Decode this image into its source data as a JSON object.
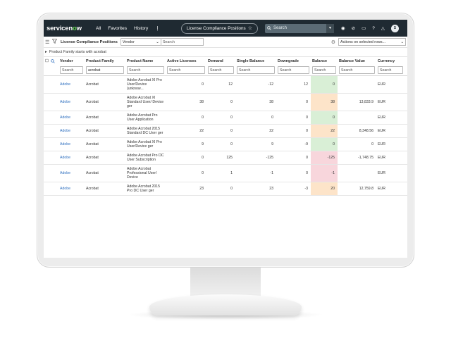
{
  "app": {
    "logo_text_a": "servicen",
    "logo_text_o": "o",
    "logo_text_b": "w",
    "nav": [
      "All",
      "Favorites",
      "History"
    ],
    "nav_more": "⋮",
    "page_title": "License Compliance Positions",
    "search_placeholder": "Search",
    "avatar_initial": "S"
  },
  "listbar": {
    "title": "License Compliance Positions",
    "field_select": "Vendor",
    "search_placeholder": "Search",
    "actions_label": "Actions on selected rows..."
  },
  "breadcrumb": "Product Family starts with acrobat",
  "columns": [
    "Vendor",
    "Product Family",
    "Product Name",
    "Active Licenses",
    "Demand",
    "Single Balance",
    "Downgrade",
    "Balance",
    "Balance Value",
    "Currency"
  ],
  "filters": {
    "vendor": "Search",
    "family": "acrobat",
    "name": "Search",
    "active": "Search",
    "demand": "Search",
    "single": "Search",
    "down": "Search",
    "bal": "Search",
    "balval": "Search",
    "cur": "Search"
  },
  "rows": [
    {
      "vendor": "Adobe",
      "family": "Acrobat",
      "name": "Adobe Acrobat XI Pro User/Device (unknow...",
      "active": "0",
      "demand": "12",
      "single": "-12",
      "down": "12",
      "balance": "0",
      "balance_value": "",
      "currency": "EUR",
      "status": "ok"
    },
    {
      "vendor": "Adobe",
      "family": "Acrobat",
      "name": "Adobe Acrobat XI Standard User/ Device ger",
      "active": "38",
      "demand": "0",
      "single": "38",
      "down": "0",
      "balance": "38",
      "balance_value": "13,833.9",
      "currency": "EUR",
      "status": "surplus"
    },
    {
      "vendor": "Adobe",
      "family": "Acrobat",
      "name": "Adobe Acrobat Pro User Application",
      "active": "0",
      "demand": "0",
      "single": "0",
      "down": "0",
      "balance": "0",
      "balance_value": "",
      "currency": "EUR",
      "status": "ok"
    },
    {
      "vendor": "Adobe",
      "family": "Acrobat",
      "name": "Adobe Acrobat 2015 Standard DC User ger",
      "active": "22",
      "demand": "0",
      "single": "22",
      "down": "0",
      "balance": "22",
      "balance_value": "8,348.56",
      "currency": "EUR",
      "status": "surplus"
    },
    {
      "vendor": "Adobe",
      "family": "Acrobat",
      "name": "Adobe Acrobat XI Pro User/Device ger",
      "active": "9",
      "demand": "0",
      "single": "9",
      "down": "-9",
      "balance": "0",
      "balance_value": "0",
      "currency": "EUR",
      "status": "ok"
    },
    {
      "vendor": "Adobe",
      "family": "Acrobat",
      "name": "Adobe Acrobat Pro DC User Subscription",
      "active": "0",
      "demand": "125",
      "single": "-125",
      "down": "0",
      "balance": "-125",
      "balance_value": "-1,748.75",
      "currency": "EUR",
      "status": "deficit"
    },
    {
      "vendor": "Adobe",
      "family": "Acrobat",
      "name": "Adobe Acrobat Professional User/ Device",
      "active": "0",
      "demand": "1",
      "single": "-1",
      "down": "0",
      "balance": "-1",
      "balance_value": "",
      "currency": "EUR",
      "status": "deficit"
    },
    {
      "vendor": "Adobe",
      "family": "Acrobat",
      "name": "Adobe Acrobat 2015 Pro DC User ger",
      "active": "23",
      "demand": "0",
      "single": "23",
      "down": "-3",
      "balance": "20",
      "balance_value": "12,759.8",
      "currency": "EUR",
      "status": "surplus"
    }
  ],
  "colors": {
    "nav_bg": "#1f2a32",
    "accent_green": "#62d84e",
    "link": "#2e6fbf",
    "status_ok": "#d9efd6",
    "status_surplus": "#fde4c9",
    "status_deficit": "#f8d6dc"
  },
  "icons": {
    "hamburger": "☰",
    "filter": "funnel-icon",
    "gear": "⚙",
    "search": "🔍",
    "star": "☆"
  }
}
